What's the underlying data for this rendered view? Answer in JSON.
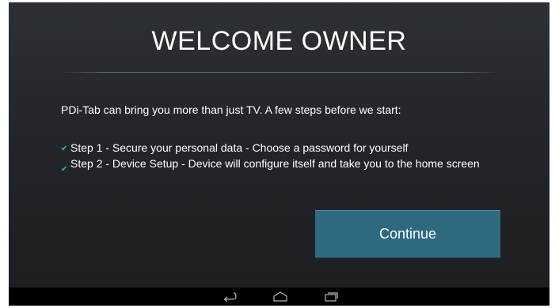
{
  "welcome": {
    "title": "WELCOME OWNER",
    "intro": "PDi-Tab can bring you more than just TV. A few steps before we start:",
    "steps": [
      {
        "label": "Step 1 - Secure your personal data - Choose a password for yourself",
        "checked": true
      },
      {
        "label": "Step 2 - Device Setup - Device will configure itself and take you to the home screen",
        "checked": true
      }
    ],
    "continue_label": "Continue"
  },
  "navbar": {
    "icons": [
      "back-icon",
      "home-icon",
      "recent-apps-icon"
    ]
  },
  "colors": {
    "accent": "#33b5e5",
    "button": "#2e6a7f"
  }
}
